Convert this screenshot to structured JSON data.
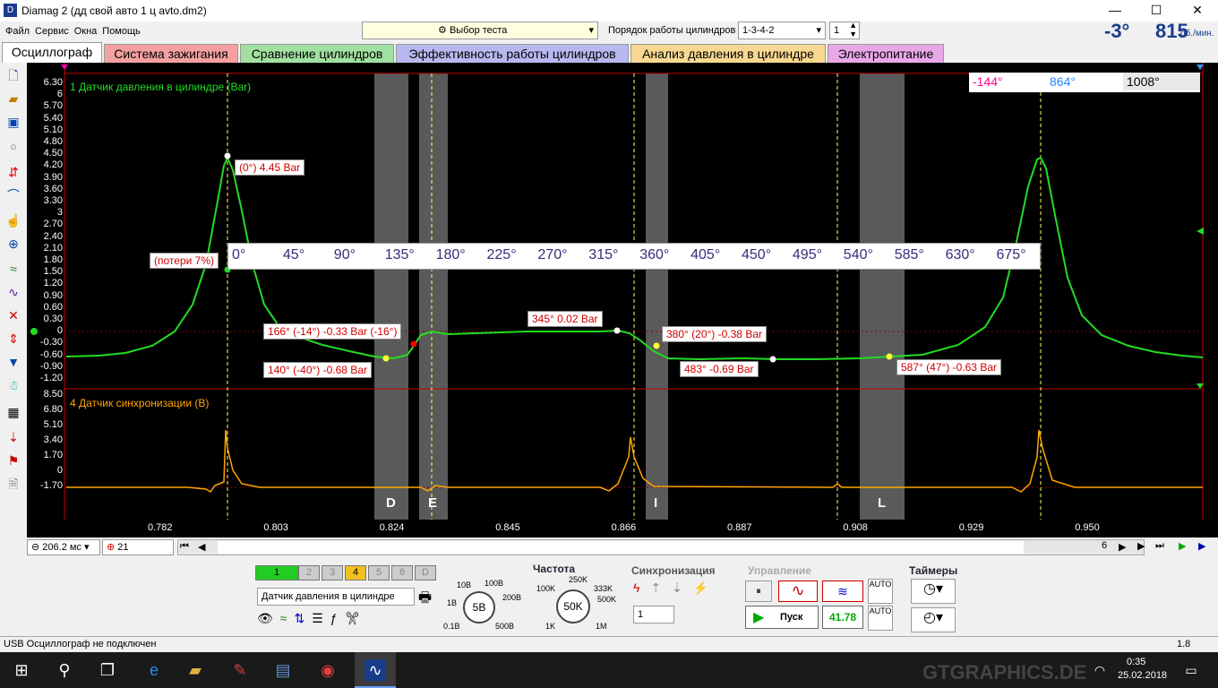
{
  "window": {
    "title": "Diamag 2 (дд свой авто 1 ц avto.dm2)",
    "minimize": "—",
    "maximize": "☐",
    "close": "✕"
  },
  "menu": [
    "Файл",
    "Сервис",
    "Окна",
    "Помощь"
  ],
  "toolbar": {
    "test_select": "Выбор теста",
    "cyl_order_label": "Порядок работы цилиндров",
    "cyl_order_value": "1-3-4-2",
    "cyl_num": "1"
  },
  "rpm": {
    "angle": "-3°",
    "value": "815",
    "unit": "об./мин."
  },
  "tabs": [
    {
      "label": "Осциллограф",
      "color": "#ffffff"
    },
    {
      "label": "Система зажигания",
      "color": "#f4a0a0"
    },
    {
      "label": "Сравнение цилиндров",
      "color": "#a0e0a0"
    },
    {
      "label": "Эффективность работы цилиндров",
      "color": "#b8b8f0"
    },
    {
      "label": "Анализ давления в цилиндре",
      "color": "#f8d890"
    },
    {
      "label": "Электропитание",
      "color": "#e8a8e8"
    }
  ],
  "markers": {
    "m1": "-144°",
    "m2": "864°",
    "delta": "1008°"
  },
  "ch1": {
    "title": "1 Датчик давления в цилиндре (Bar)",
    "ticks": [
      "6.30",
      "6",
      "5.70",
      "5.40",
      "5.10",
      "4.80",
      "4.50",
      "4.20",
      "3.90",
      "3.60",
      "3.30",
      "3",
      "2.70",
      "2.40",
      "2.10",
      "1.80",
      "1.50",
      "1.20",
      "0.90",
      "0.60",
      "0.30",
      "0",
      "-0.30",
      "-0.60",
      "-0.90",
      "-1.20"
    ]
  },
  "ch4": {
    "title": "4 Датчик синхронизации (В)",
    "ticks": [
      "8.50",
      "6.80",
      "5.10",
      "3.40",
      "1.70",
      "0",
      "-1.70"
    ]
  },
  "annotations": {
    "a1": "(0°) 4.45 Bar",
    "a2": "(потери 7%)",
    "a3": "166° (-14°) -0.33 Bar (-16°)",
    "a4": "140° (-40°) -0.68 Bar",
    "a5": "345° 0.02 Bar",
    "a6": "380° (20°) -0.38 Bar",
    "a7": "483° -0.69 Bar",
    "a8": "587° (47°) -0.63 Bar"
  },
  "degree_scale": [
    "0°",
    "45°",
    "90°",
    "135°",
    "180°",
    "225°",
    "270°",
    "315°",
    "360°",
    "405°",
    "450°",
    "495°",
    "540°",
    "585°",
    "630°",
    "675°"
  ],
  "zones": [
    "D",
    "E",
    "I",
    "L"
  ],
  "xticks": [
    "0.782",
    "0.803",
    "0.824",
    "0.845",
    "0.866",
    "0.887",
    "0.908",
    "0.929",
    "0.950"
  ],
  "timebase": {
    "value": "206.2 мс",
    "count": "21",
    "page": "6"
  },
  "channels": {
    "buttons": [
      "1",
      "2",
      "3",
      "4",
      "5",
      "6",
      "D"
    ],
    "name": "Датчик давления в цилиндре",
    "volt": "5В",
    "volt_ticks": [
      "10В",
      "100В",
      "1В",
      "200В",
      "0.1В",
      "500В"
    ]
  },
  "freq": {
    "title": "Частота",
    "value": "50K",
    "ticks": [
      "250K",
      "100K",
      "333K",
      "500K",
      "1K",
      "1M"
    ]
  },
  "sync": {
    "title": "Синхронизация",
    "value": "1"
  },
  "control": {
    "title": "Управление",
    "start": "Пуск",
    "value": "41.78"
  },
  "timers": {
    "title": "Таймеры"
  },
  "status": {
    "text": "USB Осциллограф не подключен",
    "right": "1.8"
  },
  "taskbar": {
    "time": "0:35",
    "date": "25.02.2018",
    "watermark": "GTGRAPHICS.DE"
  },
  "colors": {
    "trace1": "#22dd22",
    "trace4": "#ffa500",
    "bg": "#000000",
    "marker": "#ffff66"
  }
}
